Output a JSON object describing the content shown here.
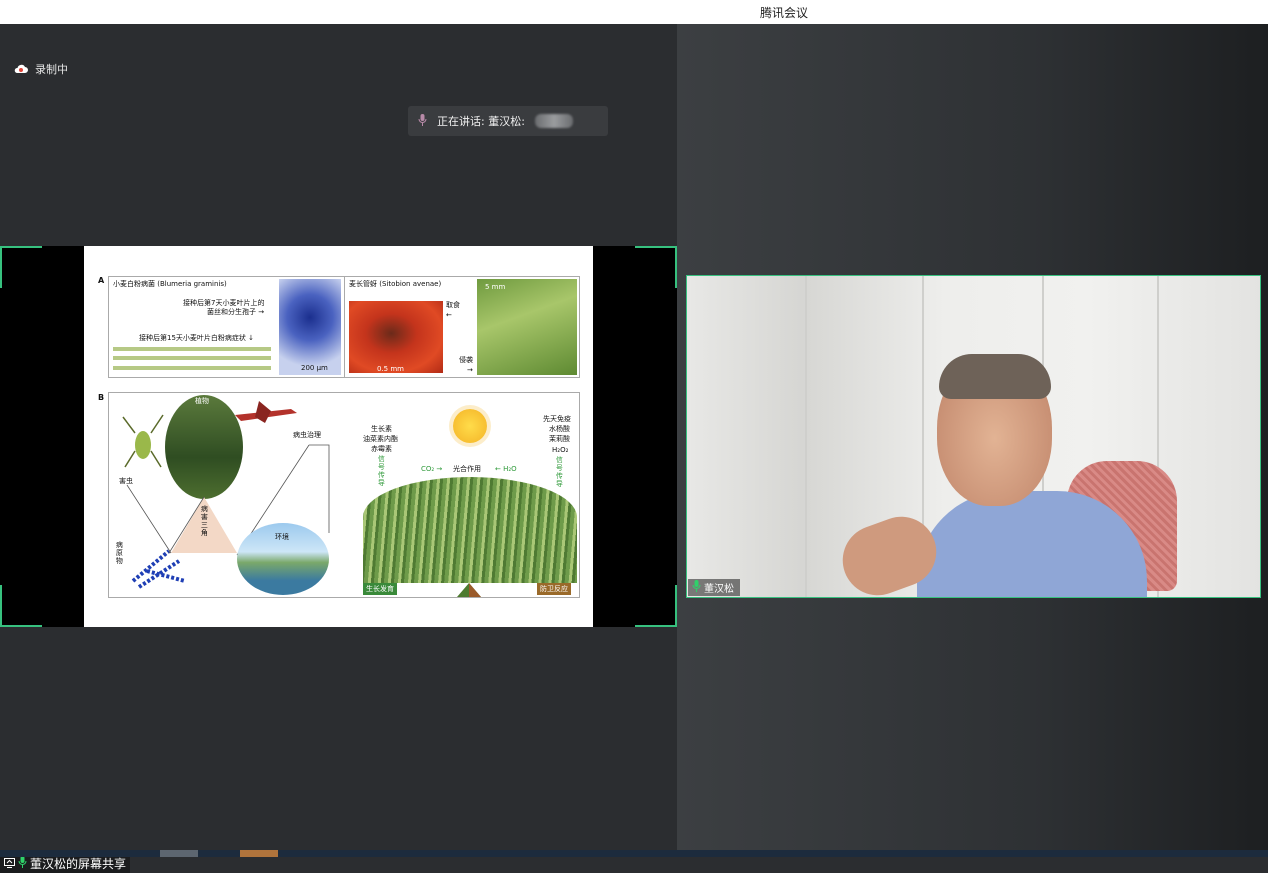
{
  "window": {
    "title": "腾讯会议"
  },
  "recording": {
    "label": "录制中"
  },
  "speaking": {
    "label": "正在讲话: 董汉松:"
  },
  "slide": {
    "panelA": {
      "letter": "A",
      "left_title": "小麦白粉病菌 (Blumeria graminis)",
      "day7_line1": "接种后第7天小麦叶片上的",
      "day7_line2": "菌丝和分生孢子 →",
      "day15": "接种后第15天小麦叶片白粉病症状 ↓",
      "scale_left": "200 μm",
      "right_title": "麦长管蚜 (Sitobion avenae)",
      "scale_mid": "0.5 mm",
      "scale_right": "5 mm",
      "feed": "取食",
      "feed_arrow": "←",
      "invade": "侵袭",
      "invade_arrow": "→"
    },
    "panelB": {
      "letter": "B",
      "plant": "植物",
      "pest": "害虫",
      "pathogen": "病原物",
      "control": "病虫治理",
      "env": "环境",
      "triangle": "病害三角",
      "growth_hormones_1": "生长素",
      "growth_hormones_2": "油菜素内酯",
      "growth_hormones_3": "赤霉素",
      "signal_left": "信号传导",
      "immunity_1": "先天免疫",
      "immunity_2": "水杨酸",
      "immunity_3": "茉莉酸",
      "immunity_4": "H₂O₂",
      "signal_right": "信号传导",
      "co2": "CO₂ →",
      "photosynthesis": "光合作用",
      "h2o": "← H₂O",
      "growth_tag": "生长发育",
      "defense_tag": "防卫反应"
    }
  },
  "video": {
    "participant_name": "董汉松"
  },
  "share": {
    "label": "董汉松的屏幕共享"
  },
  "colors": {
    "accent": "#37c17f",
    "bg": "#2b2d30"
  }
}
